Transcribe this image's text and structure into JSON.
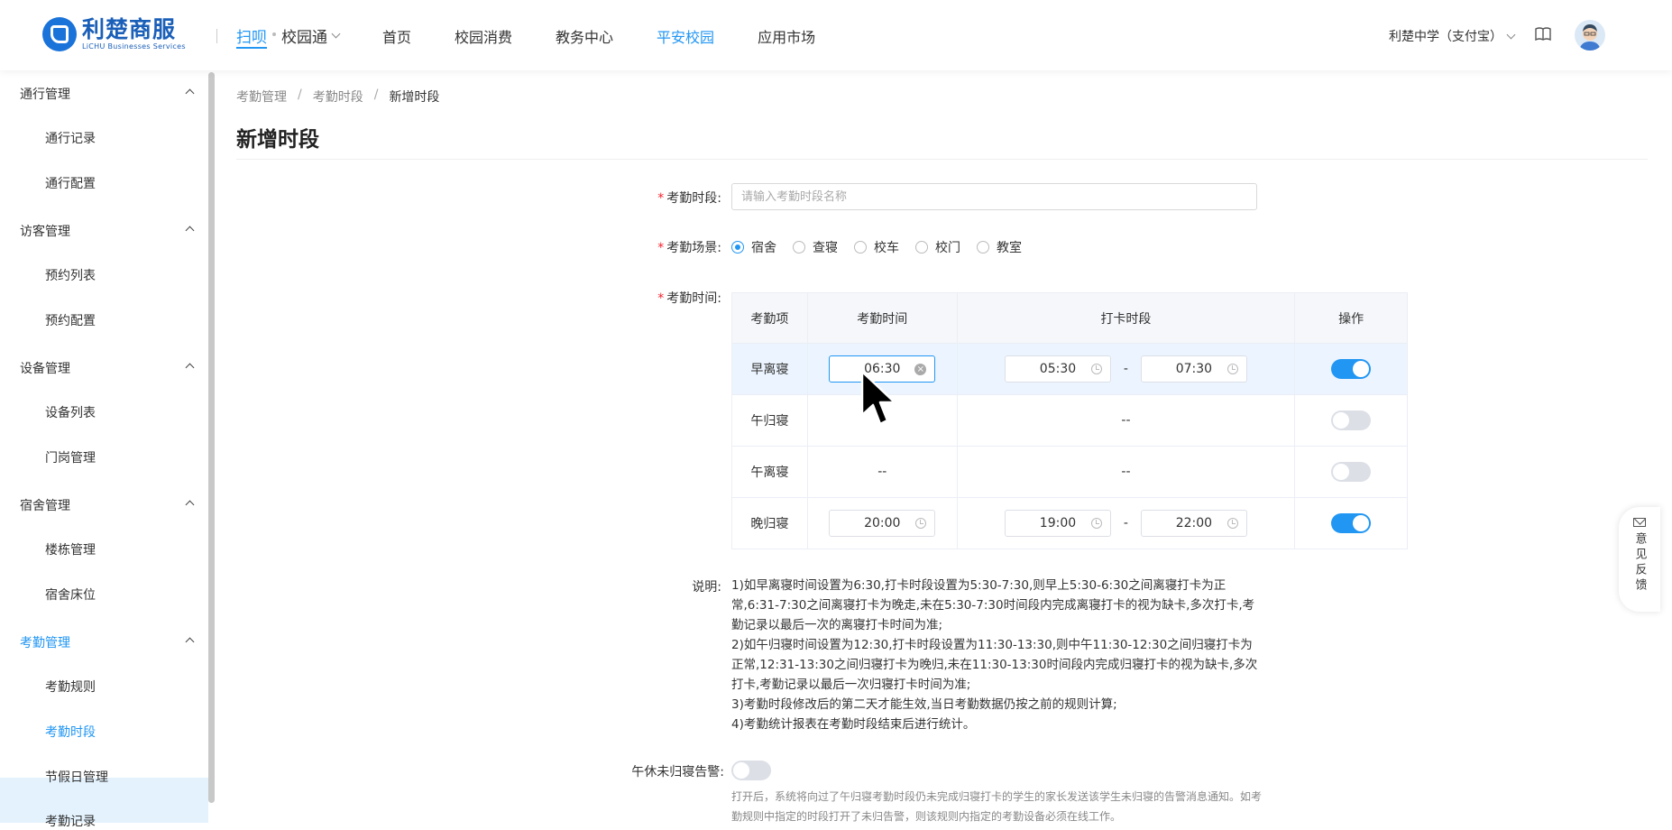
{
  "header": {
    "logo_cn": "利楚商服",
    "logo_en": "LiCHU Businesses Services",
    "scan": "扫呗",
    "campus_switch": "校园通",
    "nav": [
      "首页",
      "校园消费",
      "教务中心",
      "平安校园",
      "应用市场"
    ],
    "nav_active_index": 3,
    "school": "利楚中学（支付宝）"
  },
  "sidebar": {
    "groups": [
      {
        "label": "通行管理",
        "items": [
          "通行记录",
          "通行配置"
        ]
      },
      {
        "label": "访客管理",
        "items": [
          "预约列表",
          "预约配置"
        ]
      },
      {
        "label": "设备管理",
        "items": [
          "设备列表",
          "门岗管理"
        ]
      },
      {
        "label": "宿舍管理",
        "items": [
          "楼栋管理",
          "宿舍床位"
        ]
      },
      {
        "label": "考勤管理",
        "items": [
          "考勤规则",
          "考勤时段",
          "节假日管理",
          "考勤记录"
        ]
      }
    ],
    "active_group": "考勤管理",
    "active_item": "考勤时段"
  },
  "breadcrumb": [
    "考勤管理",
    "考勤时段",
    "新增时段"
  ],
  "page_title": "新增时段",
  "form": {
    "period_label": "考勤时段:",
    "period_placeholder": "请输入考勤时段名称",
    "scene_label": "考勤场景:",
    "scenes": [
      "宿舍",
      "查寝",
      "校车",
      "校门",
      "教室"
    ],
    "scene_selected": "宿舍",
    "time_label": "考勤时间:",
    "table": {
      "headers": [
        "考勤项",
        "考勤时间",
        "打卡时段",
        "操作"
      ],
      "rows": [
        {
          "item": "早离寝",
          "time": "06:30",
          "start": "05:30",
          "end": "07:30",
          "enabled": true,
          "focused": true
        },
        {
          "item": "午归寝",
          "time": "",
          "range_text": "--",
          "enabled": false
        },
        {
          "item": "午离寝",
          "time_text": "--",
          "range_text": "--",
          "enabled": false
        },
        {
          "item": "晚归寝",
          "time": "20:00",
          "start": "19:00",
          "end": "22:00",
          "enabled": true
        }
      ],
      "range_sep": "-"
    },
    "notes_label": "说明:",
    "notes": [
      "1)如早离寝时间设置为6:30,打卡时段设置为5:30-7:30,则早上5:30-6:30之间离寝打卡为正常,6:31-7:30之间离寝打卡为晚走,未在5:30-7:30时间段内完成离寝打卡的视为缺卡,多次打卡,考勤记录以最后一次的离寝打卡时间为准;",
      "2)如午归寝时间设置为12:30,打卡时段设置为11:30-13:30,则中午11:30-12:30之间归寝打卡为正常,12:31-13:30之间归寝打卡为晚归,未在11:30-13:30时间段内完成归寝打卡的视为缺卡,多次打卡,考勤记录以最后一次归寝打卡时间为准;",
      "3)考勤时段修改后的第二天才能生效,当日考勤数据仍按之前的规则计算;",
      "4)考勤统计报表在考勤时段结束后进行统计。"
    ],
    "alert_label": "午休未归寝告警:",
    "alert_enabled": false,
    "alert_desc": "打开后，系统将向过了午归寝考勤时段仍未完成归寝打卡的学生的家长发送该学生未归寝的告警消息通知。如考勤规则中指定的时段打开了未归告警，则该规则内指定的考勤设备必须在线工作。"
  },
  "feedback": "意见反馈",
  "colors": {
    "primary": "#2196f3",
    "required": "#f5222d",
    "active_bg": "#e3f2fd"
  }
}
